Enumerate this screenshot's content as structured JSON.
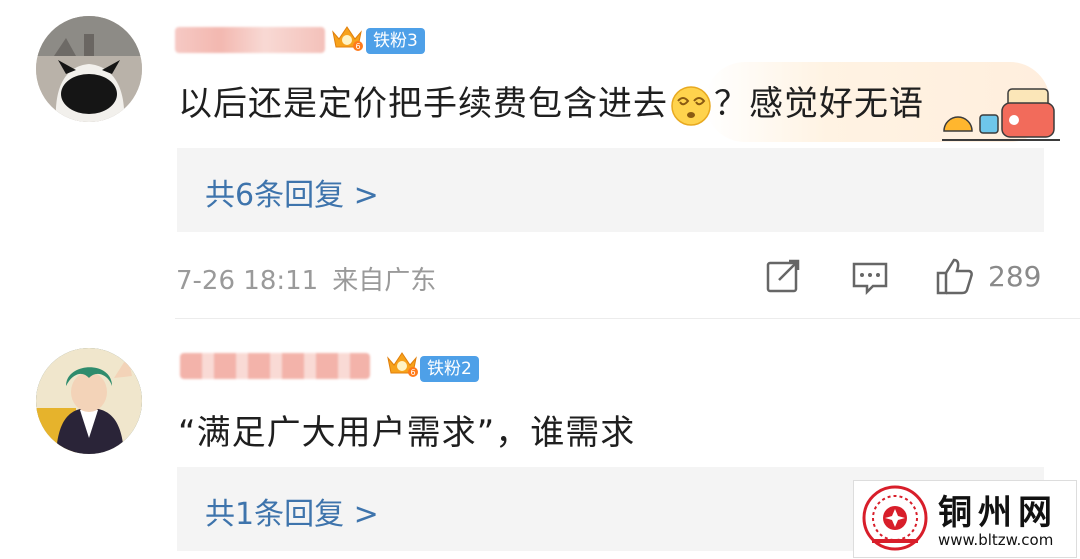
{
  "comments": [
    {
      "badge": "铁粉3",
      "text_before": "以后还是定价把手续费包含进去",
      "text_after": "？感觉好无语",
      "emoji": "dizzy-face-emoji",
      "reply_link": "共6条回复 >",
      "date": "7-26 18:11",
      "location": "来自广东",
      "likes": "289"
    },
    {
      "badge": "铁粉2",
      "text": "“满足广大用户需求”，谁需求",
      "reply_link": "共1条回复 >"
    }
  ],
  "icons": {
    "share": "share-icon",
    "comment": "comment-icon",
    "like": "thumbs-up-icon",
    "crown": "fan-crown-icon"
  },
  "colors": {
    "accent_link": "#3e74ac",
    "badge_bg": "#4ea0e8",
    "reply_bg": "#f4f4f4",
    "meta_gray": "#9a9a9a"
  },
  "watermark": {
    "name": "铜州网",
    "url": "www.bltzw.com"
  }
}
